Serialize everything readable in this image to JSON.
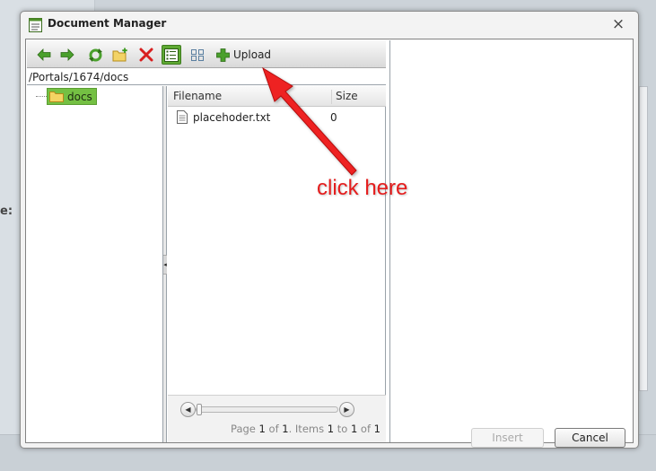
{
  "window": {
    "title": "Document Manager",
    "close_symbol": "×"
  },
  "background": {
    "label_fragment": "e:"
  },
  "toolbar": {
    "buttons": [
      {
        "name": "back-icon"
      },
      {
        "name": "forward-icon"
      },
      {
        "name": "refresh-icon"
      },
      {
        "name": "new-folder-icon"
      },
      {
        "name": "delete-icon"
      },
      {
        "name": "list-view-icon",
        "active": true
      },
      {
        "name": "thumbnail-view-icon"
      }
    ],
    "upload_label": "Upload"
  },
  "path": "/Portals/1674/docs",
  "tree": {
    "items": [
      {
        "label": "docs",
        "selected": true
      }
    ]
  },
  "grid": {
    "columns": {
      "filename": "Filename",
      "size": "Size"
    },
    "rows": [
      {
        "name": "placehoder.txt",
        "size": "0"
      }
    ],
    "pager": {
      "page_word": "Page",
      "page": "1",
      "of_word": "of",
      "page_total": "1",
      "items_word": ". Items",
      "from": "1",
      "to_word": "to",
      "to": "1",
      "of_word2": "of",
      "total": "1"
    },
    "scroll_left_symbol": "◀",
    "scroll_right_symbol": "▶"
  },
  "splitter_symbol": "◂",
  "footer": {
    "insert_label": "Insert",
    "cancel_label": "Cancel"
  },
  "annotation": {
    "text": "click here",
    "color": "#e51d1d"
  },
  "colors": {
    "selected_green": "#74c043",
    "annotation_red": "#e51d1d"
  }
}
